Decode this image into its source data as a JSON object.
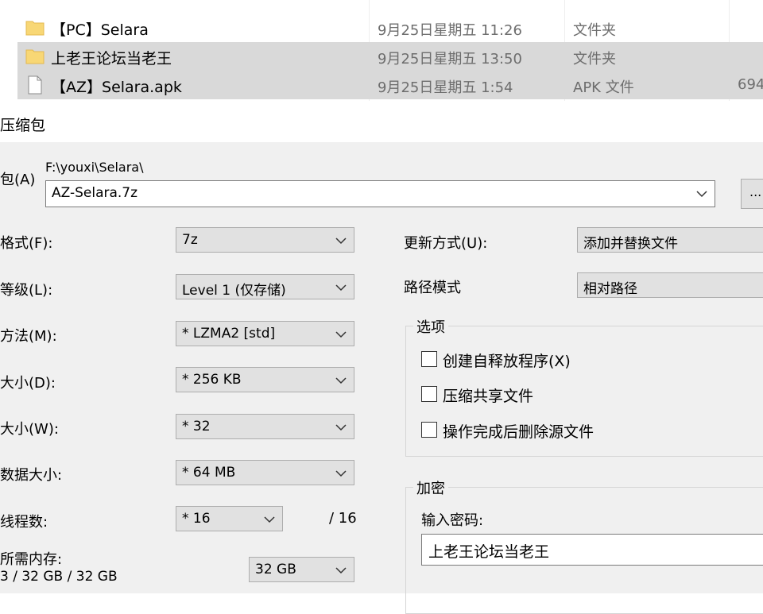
{
  "explorer": {
    "files": [
      {
        "name": "【PC】Selara",
        "date": "9月25日星期五 11:26",
        "type": "文件夹",
        "size": "",
        "icon": "folder-icon",
        "selected": false
      },
      {
        "name": "上老王论坛当老王",
        "date": "9月25日星期五 13:50",
        "type": "文件夹",
        "size": "",
        "icon": "folder-icon",
        "selected": true
      },
      {
        "name": "【AZ】Selara.apk",
        "date": "9月25日星期五 1:54",
        "type": "APK 文件",
        "size": "694",
        "icon": "file-icon",
        "selected": true
      }
    ]
  },
  "dialog": {
    "title": "压缩包",
    "archive": {
      "label": "包(A)",
      "path": "F:\\youxi\\Selara\\",
      "filename": "AZ-Selara.7z",
      "browse_label": "..."
    },
    "format": {
      "label": "格式(F):",
      "value": "7z"
    },
    "level": {
      "label": "等级(L):",
      "value": "Level 1 (仅存储)"
    },
    "method": {
      "label": "方法(M):",
      "value": "*  LZMA2 [std]"
    },
    "dict_size": {
      "label": "大小(D):",
      "value": "*  256 KB"
    },
    "word_size": {
      "label": "大小(W):",
      "value": "*  32"
    },
    "solid_size": {
      "label": "数据大小:",
      "value": "*  64 MB"
    },
    "threads": {
      "label": "线程数:",
      "value": "*  16",
      "max": "/ 16"
    },
    "memory": {
      "label": "所需内存:",
      "usage": "3 / 32 GB / 32 GB",
      "value": "32 GB"
    },
    "update_mode": {
      "label": "更新方式(U):",
      "value": "添加并替换文件"
    },
    "path_mode": {
      "label": "路径模式",
      "value": "相对路径"
    },
    "options": {
      "title": "选项",
      "items": [
        {
          "label": "创建自释放程序(X)",
          "checked": false
        },
        {
          "label": "压缩共享文件",
          "checked": false
        },
        {
          "label": "操作完成后删除源文件",
          "checked": false
        }
      ]
    },
    "encryption": {
      "title": "加密",
      "password_label": "输入密码:",
      "password_value": "上老王论坛当老王"
    }
  },
  "colors": {
    "selection": "#d9d9d9",
    "dialog_bg": "#f0f0f0",
    "combo_bg": "#e1e1e1",
    "folder_yellow": "#f8d775"
  }
}
